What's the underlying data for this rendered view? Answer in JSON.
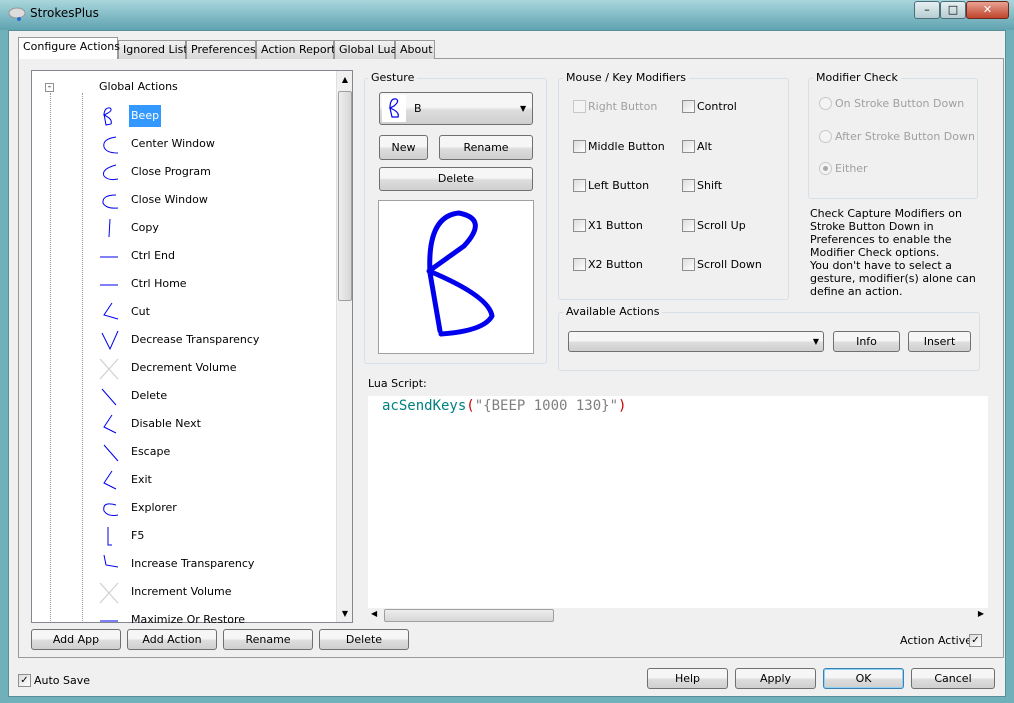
{
  "window": {
    "title": "StrokesPlus"
  },
  "tabs": [
    {
      "label": "Configure Actions",
      "active": true
    },
    {
      "label": "Ignored List"
    },
    {
      "label": "Preferences"
    },
    {
      "label": "Action Report"
    },
    {
      "label": "Global Lua"
    },
    {
      "label": "About"
    }
  ],
  "tree": {
    "root": "Global Actions",
    "selected": "Beep",
    "items": [
      "Beep",
      "Center Window",
      "Close Program",
      "Close Window",
      "Copy",
      "Ctrl End",
      "Ctrl Home",
      "Cut",
      "Decrease Transparency",
      "Decrement Volume",
      "Delete",
      "Disable Next",
      "Escape",
      "Exit",
      "Explorer",
      "F5",
      "Increase Transparency",
      "Increment Volume",
      "Maximize Or Restore"
    ]
  },
  "tree_buttons": {
    "add_app": "Add App",
    "add_action": "Add Action",
    "rename": "Rename",
    "delete": "Delete"
  },
  "gesture": {
    "label": "Gesture",
    "selected": "B",
    "new": "New",
    "rename": "Rename",
    "delete": "Delete"
  },
  "modifiers": {
    "label": "Mouse / Key Modifiers",
    "left": [
      {
        "label": "Right Button",
        "disabled": true,
        "checked": false
      },
      {
        "label": "Middle Button",
        "checked": false
      },
      {
        "label": "Left Button",
        "checked": false
      },
      {
        "label": "X1 Button",
        "checked": false
      },
      {
        "label": "X2 Button",
        "checked": false
      }
    ],
    "right": [
      {
        "label": "Control",
        "checked": false
      },
      {
        "label": "Alt",
        "checked": false
      },
      {
        "label": "Shift",
        "checked": false
      },
      {
        "label": "Scroll Up",
        "checked": false
      },
      {
        "label": "Scroll Down",
        "checked": false
      }
    ]
  },
  "modifier_check": {
    "label": "Modifier Check",
    "options": [
      "On Stroke Button Down",
      "After Stroke Button Down",
      "Either"
    ],
    "selected": "Either",
    "note1": "Check Capture Modifiers on Stroke Button Down in Preferences to enable the Modifier Check options.",
    "note2": "You don't have to select a gesture, modifier(s) alone can define an action."
  },
  "available_actions": {
    "label": "Available Actions",
    "value": "",
    "info": "Info",
    "insert": "Insert"
  },
  "lua": {
    "label": "Lua Script:",
    "func": "acSendKeys",
    "open": "(",
    "string": "\"{BEEP 1000 130}\"",
    "close": ")"
  },
  "action_active": {
    "label": "Action Active",
    "checked": true
  },
  "auto_save": {
    "label": "Auto Save",
    "checked": true
  },
  "footer": {
    "help": "Help",
    "apply": "Apply",
    "ok": "OK",
    "cancel": "Cancel"
  },
  "colors": {
    "selection": "#3399ff",
    "stroke": "#0000ee",
    "lua_func": "#008080",
    "lua_string": "#808080",
    "lua_paren": "#cc0000"
  }
}
